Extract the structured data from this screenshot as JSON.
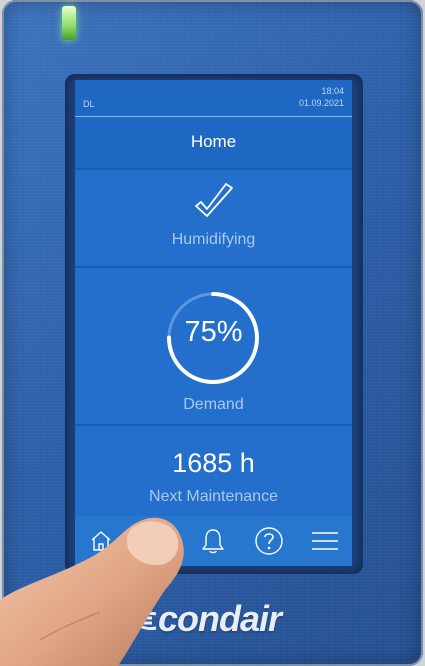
{
  "status_bar": {
    "left": "DL",
    "time": "18:04",
    "date": "01.09.2021"
  },
  "title": "Home",
  "status_panel": {
    "icon": "check-icon",
    "label": "Humidifying"
  },
  "demand_panel": {
    "value_text": "75%",
    "fraction": 0.75,
    "label": "Demand"
  },
  "maintenance_panel": {
    "value": "1685 h",
    "label": "Next Maintenance"
  },
  "nav_bar": {
    "items": [
      {
        "icon": "home-icon"
      },
      {
        "icon": "device-icon"
      },
      {
        "icon": "bell-icon"
      },
      {
        "icon": "help-icon"
      },
      {
        "icon": "menu-icon"
      }
    ]
  },
  "brand": {
    "logo": "condair"
  },
  "colors": {
    "accent": "#1e68c4",
    "panel": "#236fcb",
    "led": "#8ddc63"
  }
}
